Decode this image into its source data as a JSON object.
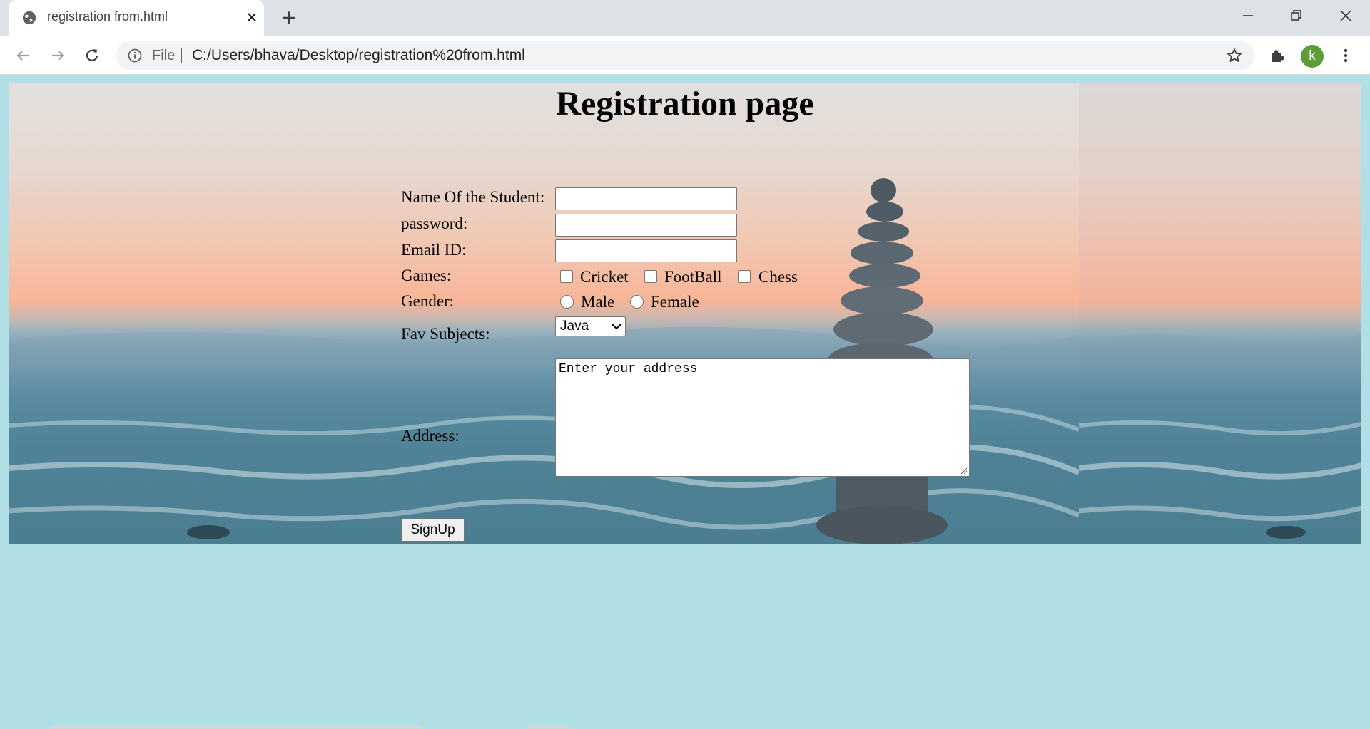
{
  "browser": {
    "tab_title": "registration from.html",
    "address_scheme": "File",
    "address_url": "C:/Users/bhava/Desktop/registration%20from.html",
    "profile_initial": "k",
    "icons": [
      "globe-icon",
      "close-icon",
      "plus-icon",
      "minimize-icon",
      "restore-icon",
      "window-close-icon",
      "back-icon",
      "forward-icon",
      "reload-icon",
      "info-icon",
      "star-icon",
      "puzzle-icon",
      "kebab-menu-icon"
    ]
  },
  "page": {
    "heading": "Registration page",
    "labels": {
      "name": "Name Of the Student:",
      "password": "password:",
      "email": "Email ID:",
      "games": "Games:",
      "gender": "Gender:",
      "subjects": "Fav Subjects:",
      "address": "Address:"
    },
    "games": [
      "Cricket",
      "FootBall",
      "Chess"
    ],
    "genders": [
      "Male",
      "Female"
    ],
    "subject_selected": "Java",
    "address_placeholder": "Enter your address",
    "signup_label": "SignUp"
  },
  "colors": {
    "page_background": "#b0dfe5",
    "profile_avatar": "#5c9c3b"
  }
}
